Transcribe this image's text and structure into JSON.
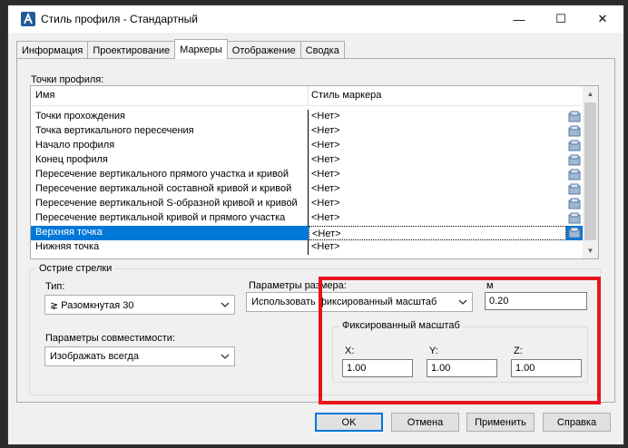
{
  "window": {
    "title": "Стиль профиля - Стандартный",
    "controls": {
      "minimize": "—",
      "maximize": "☐",
      "close": "✕"
    }
  },
  "tabs": [
    "Информация",
    "Проектирование",
    "Маркеры",
    "Отображение",
    "Сводка"
  ],
  "active_tab": "Маркеры",
  "profile_points": {
    "label": "Точки профиля:",
    "columns": [
      "Имя",
      "Стиль маркера"
    ],
    "rows": [
      {
        "name": "Точки прохождения",
        "style": "<Нет>"
      },
      {
        "name": "Точка вертикального пересечения",
        "style": "<Нет>"
      },
      {
        "name": "Начало профиля",
        "style": "<Нет>"
      },
      {
        "name": "Конец профиля",
        "style": "<Нет>"
      },
      {
        "name": "Пересечение вертикального прямого участка и кривой",
        "style": "<Нет>"
      },
      {
        "name": "Пересечение вертикальной составной кривой и кривой",
        "style": "<Нет>"
      },
      {
        "name": "Пересечение вертикальной S-образной кривой и кривой",
        "style": "<Нет>"
      },
      {
        "name": "Пересечение вертикальной кривой и прямого участка",
        "style": "<Нет>"
      },
      {
        "name": "Верхняя точка",
        "style": "<Нет>"
      },
      {
        "name": "Нижняя точка",
        "style": "<Нет>"
      }
    ],
    "selected_row": "Верхняя точка"
  },
  "arrowhead": {
    "group_title": "Острие стрелки",
    "type_label": "Тип:",
    "type_value": "⋧ Разомкнутая 30",
    "size_params_label": "Параметры размера:",
    "size_params_value": "Использовать фиксированный масштаб",
    "unit_label": "м",
    "unit_value": "0.20",
    "compat_label": "Параметры совместимости:",
    "compat_value": "Изображать всегда",
    "fixed_scale": {
      "title": "Фиксированный масштаб",
      "x_label": "X:",
      "x_value": "1.00",
      "y_label": "Y:",
      "y_value": "1.00",
      "z_label": "Z:",
      "z_value": "1.00"
    }
  },
  "buttons": {
    "ok": "OK",
    "cancel": "Отмена",
    "apply": "Применить",
    "help": "Справка"
  },
  "colors": {
    "selection": "#0078d7",
    "highlight_box": "#e8141b"
  }
}
